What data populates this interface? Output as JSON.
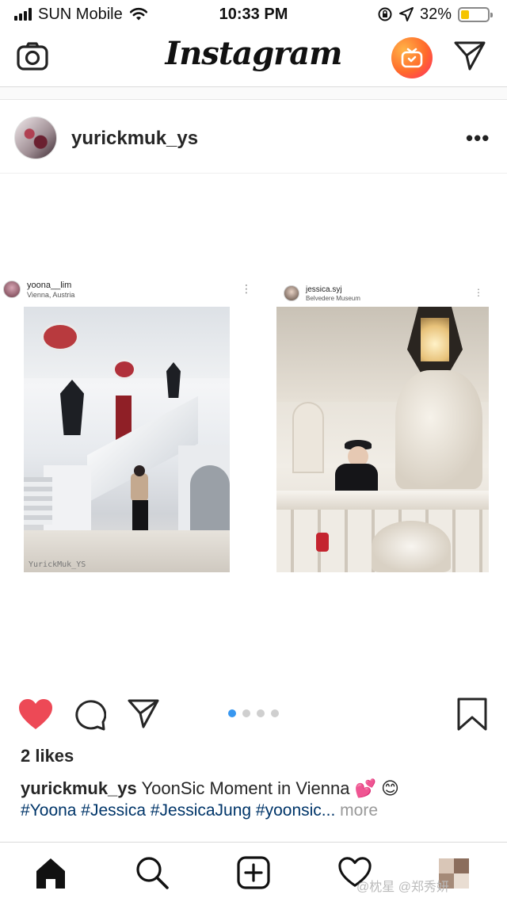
{
  "status_bar": {
    "carrier": "SUN Mobile",
    "time": "10:33 PM",
    "battery": "32%",
    "battery_level": 0.32
  },
  "header": {
    "title": "Instagram"
  },
  "post": {
    "username": "yurickmuk_ys",
    "images": [
      {
        "username": "yoona__lim",
        "location": "Vienna, Austria",
        "watermark": "YurickMuk_YS"
      },
      {
        "username": "jessica.syj",
        "location": "Belvedere Museum"
      }
    ],
    "carousel": {
      "count": 4,
      "active_index": 0
    },
    "likes": "2 likes",
    "caption_user": "yurickmuk_ys",
    "caption_text": "YoonSic Moment in Vienna 💕 😊",
    "hashtags": "#Yoona #Jessica #JessicaJung #yoonsic...",
    "more_label": "more"
  },
  "watermark_text": "@枕星 @郑秀妍",
  "colors": {
    "like_red": "#ed4956",
    "link_blue": "#003569",
    "dot_active": "#3897f0"
  },
  "icons": [
    "camera-icon",
    "igtv-icon",
    "direct-message-icon",
    "more-options-icon",
    "heart-icon",
    "comment-icon",
    "share-icon",
    "bookmark-icon",
    "home-icon",
    "search-icon",
    "add-post-icon",
    "activity-heart-icon",
    "profile-avatar"
  ]
}
